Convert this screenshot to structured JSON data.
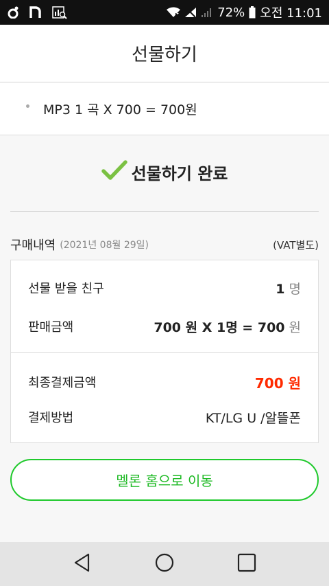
{
  "status_bar": {
    "battery_percent": "72%",
    "clock": "오전 11:01",
    "left_icons": [
      "notification-dot-icon",
      "n-app-icon",
      "chart-search-icon"
    ],
    "right_icons": [
      "wifi-icon",
      "no-signal-icon",
      "signal-bars-icon",
      "battery-icon"
    ]
  },
  "header": {
    "title": "선물하기"
  },
  "item": {
    "text": "MP3 1 곡 X 700 = 700원"
  },
  "completion": {
    "text": "선물하기 완료",
    "icon": "check-icon",
    "check_color": "#7bc143"
  },
  "history": {
    "title": "구매내역",
    "date": "(2021년 08월 29일)",
    "vat": "(VAT별도)"
  },
  "details": {
    "friends_label": "선물 받을 친구",
    "friends_value": "1",
    "friends_unit": "명",
    "sale_label": "판매금액",
    "sale_value": "700 원 X 1명 = 700",
    "sale_unit": "원",
    "final_label": "최종결제금액",
    "final_value": "700 원",
    "method_label": "결제방법",
    "method_value": "KT/LG U /알뜰폰"
  },
  "button": {
    "label": "멜론 홈으로 이동",
    "color": "#1fc92c"
  },
  "nav": {
    "icons": [
      "back-icon",
      "home-icon",
      "recent-apps-icon"
    ]
  }
}
